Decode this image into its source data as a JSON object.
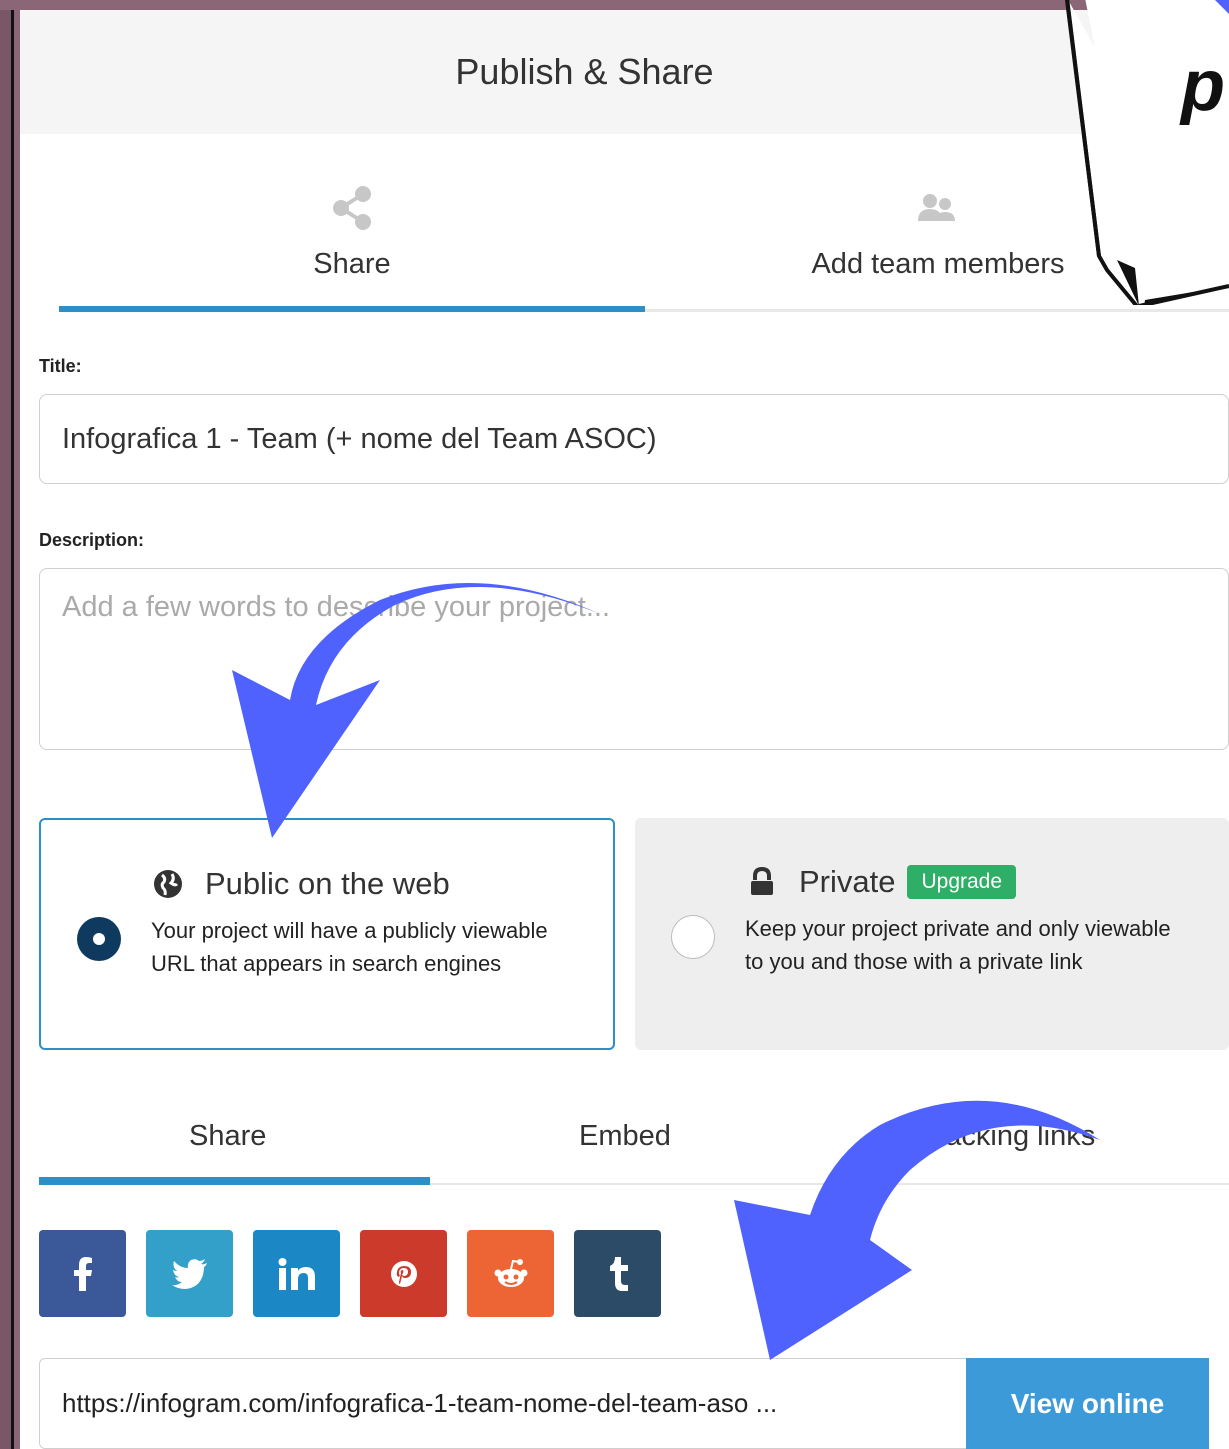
{
  "modal": {
    "title": "Publish & Share"
  },
  "top_tabs": [
    {
      "label": "Share",
      "icon": "share-icon",
      "active": true
    },
    {
      "label": "Add team members",
      "icon": "team-icon",
      "active": false
    }
  ],
  "form": {
    "title_label": "Title:",
    "title_value": "Infografica 1 - Team (+ nome del Team ASOC)",
    "description_label": "Description:",
    "description_placeholder": "Add a few words to describe your project..."
  },
  "visibility": {
    "public": {
      "heading": "Public on the web",
      "description": "Your project will have a publicly viewable URL that appears in search engines",
      "icon": "globe-icon",
      "selected": true
    },
    "private": {
      "heading": "Private",
      "badge": "Upgrade",
      "description": "Keep your project private and only viewable to you and those with a private link",
      "icon": "lock-icon",
      "selected": false
    }
  },
  "sub_tabs": [
    {
      "label": "Share",
      "active": true
    },
    {
      "label": "Embed",
      "active": false
    },
    {
      "label": "Tracking links",
      "active": false
    }
  ],
  "social": [
    {
      "name": "facebook",
      "glyph": "f",
      "color": "#3b5998"
    },
    {
      "name": "twitter",
      "glyph": "t",
      "color": "#33a0c9"
    },
    {
      "name": "linkedin",
      "glyph": "in",
      "color": "#1b87c4"
    },
    {
      "name": "pinterest",
      "glyph": "p",
      "color": "#cb3a2b"
    },
    {
      "name": "reddit",
      "glyph": "r",
      "color": "#ee6535"
    },
    {
      "name": "tumblr",
      "glyph": "t",
      "color": "#2c4b67"
    }
  ],
  "link": {
    "url": "https://infogram.com/infografica-1-team-nome-del-team-aso ...",
    "view_button": "View online"
  },
  "callout": {
    "text": "p"
  },
  "colors": {
    "accent": "#2d8fc4",
    "annotation_arrow": "#5062fd",
    "upgrade_green": "#2fae67",
    "backdrop": "#8b6676"
  }
}
